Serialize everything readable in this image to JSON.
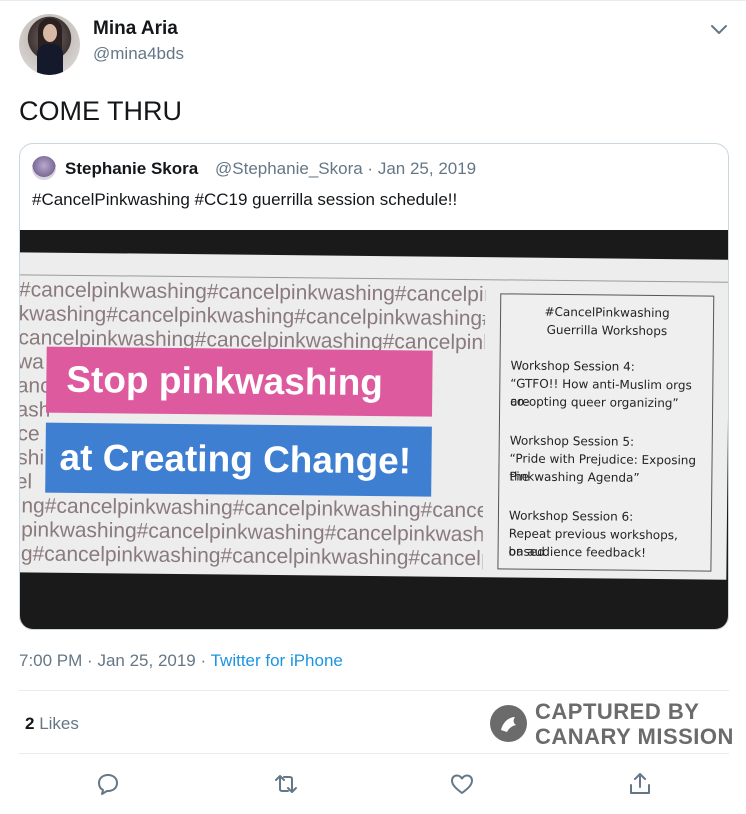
{
  "tweet": {
    "author_name": "Mina Aria",
    "author_handle": "@mina4bds",
    "text": "COME THRU",
    "time": "7:00 PM",
    "date": "Jan 25, 2019",
    "separator": "·",
    "source": "Twitter for iPhone",
    "likes_count": "2",
    "likes_label": "Likes"
  },
  "quoted": {
    "author_name": "Stephanie Skora",
    "author_handle": "@Stephanie_Skora",
    "date": "Jan 25, 2019",
    "text": "#CancelPinkwashing #CC19 guerrilla session schedule!!",
    "image": {
      "hashtag_lines": [
        "g#cancelpinkwashing#cancelpinkwashing#cancelpinkw",
        "nkwashing#cancelpinkwashing#cancelpinkwashing#ca",
        "#cancelpinkwashing#cancelpinkwashing#cancelpinkwa",
        "kwa",
        "canc",
        "vash",
        "nce",
        "ashi",
        "cel",
        "hing#cancelpinkwashing#cancelpinkwashing#cancelp",
        "elpinkwashing#cancelpinkwashing#cancelpinkwashin",
        "ing#cancelpinkwashing#cancelpinkwashing#cancelpi"
      ],
      "banner_top": "Stop pinkwashing",
      "banner_bottom": "at Creating Change!",
      "schedule": {
        "title_line1": "#CancelPinkwashing",
        "title_line2": "Guerrilla Workshops",
        "sessions": [
          {
            "heading": "Workshop Session 4:",
            "desc_line1": "“GTFO!! How anti-Muslim orgs are",
            "desc_line2": "co-opting queer organizing”"
          },
          {
            "heading": "Workshop Session 5:",
            "desc_line1": "“Pride with Prejudice: Exposing the",
            "desc_line2": "Pinkwashing Agenda”"
          },
          {
            "heading": "Workshop Session 6:",
            "desc_line1": "Repeat previous workshops, based",
            "desc_line2": "on audience feedback!"
          }
        ]
      }
    }
  },
  "watermark": {
    "line1": "CAPTURED BY",
    "line2": "CANARY MISSION"
  },
  "icons": {
    "caret": "chevron-down-icon",
    "reply": "reply-icon",
    "retweet": "retweet-icon",
    "like": "heart-icon",
    "share": "share-icon",
    "watermark": "canary-bird-icon"
  },
  "colors": {
    "link": "#1b95e0",
    "secondary_text": "#657786",
    "pink_banner": "#de5a9e",
    "blue_banner": "#3f7fd1"
  }
}
